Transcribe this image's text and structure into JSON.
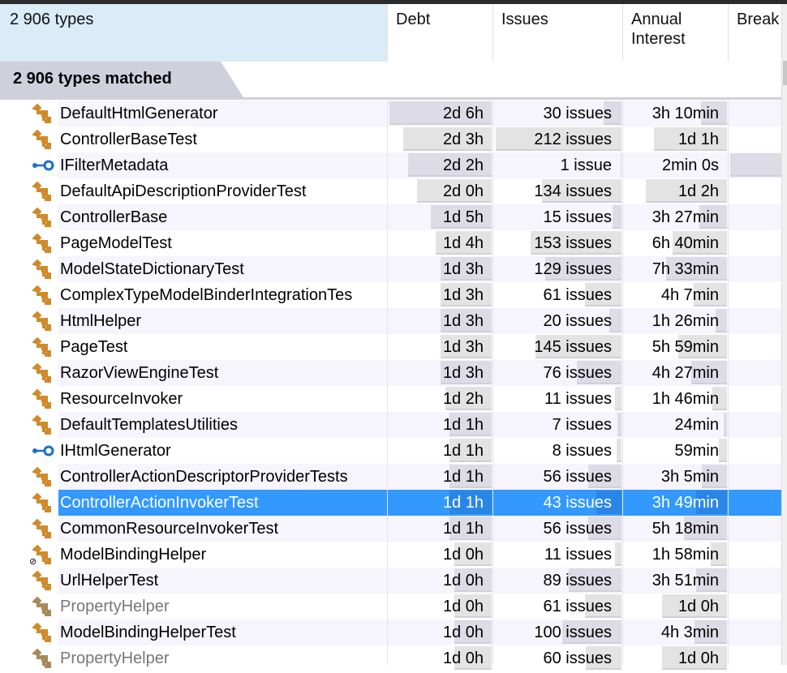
{
  "header": {
    "name": "2 906 types",
    "debt": "Debt",
    "issues": "Issues",
    "interest": "Annual Interest",
    "breaking": "Break"
  },
  "group": {
    "label": "2 906 types matched"
  },
  "colors": {
    "selection": "#3399ff",
    "class_icon": "#d08a2a",
    "interface_icon": "#1a6fc9",
    "group_header": "#cfd0dc",
    "header_first": "#d9ecf8"
  },
  "rows": [
    {
      "name": "DefaultHtmlGenerator",
      "icon": "class-icon",
      "debt": "2d  6h",
      "debt_h": 22,
      "issues": "30 issues",
      "issues_n": 30,
      "interest": "3h  10min",
      "interest_h": 3.17
    },
    {
      "name": "ControllerBaseTest",
      "icon": "class-icon",
      "debt": "2d  3h",
      "debt_h": 19,
      "issues": "212 issues",
      "issues_n": 212,
      "interest": "1d  1h",
      "interest_h": 9
    },
    {
      "name": "IFilterMetadata",
      "icon": "interface-icon",
      "debt": "2d  2h",
      "debt_h": 18,
      "issues": "1 issue",
      "issues_n": 1,
      "interest": "2min  0s",
      "interest_h": 0.03,
      "breaking": true
    },
    {
      "name": "DefaultApiDescriptionProviderTest",
      "icon": "class-icon",
      "debt": "2d  0h",
      "debt_h": 16,
      "issues": "134 issues",
      "issues_n": 134,
      "interest": "1d  2h",
      "interest_h": 10
    },
    {
      "name": "ControllerBase",
      "icon": "class-icon",
      "debt": "1d  5h",
      "debt_h": 13,
      "issues": "15 issues",
      "issues_n": 15,
      "interest": "3h  27min",
      "interest_h": 3.45
    },
    {
      "name": "PageModelTest",
      "icon": "class-icon",
      "debt": "1d  4h",
      "debt_h": 12,
      "issues": "153 issues",
      "issues_n": 153,
      "interest": "6h  40min",
      "interest_h": 6.67
    },
    {
      "name": "ModelStateDictionaryTest",
      "icon": "class-icon",
      "debt": "1d  3h",
      "debt_h": 11,
      "issues": "129 issues",
      "issues_n": 129,
      "interest": "7h  33min",
      "interest_h": 7.55
    },
    {
      "name": "ComplexTypeModelBinderIntegrationTes",
      "icon": "class-icon",
      "debt": "1d  3h",
      "debt_h": 11,
      "issues": "61 issues",
      "issues_n": 61,
      "interest": "4h  7min",
      "interest_h": 4.12
    },
    {
      "name": "HtmlHelper",
      "icon": "class-icon",
      "debt": "1d  3h",
      "debt_h": 11,
      "issues": "20 issues",
      "issues_n": 20,
      "interest": "1h  26min",
      "interest_h": 1.43
    },
    {
      "name": "PageTest",
      "icon": "class-icon",
      "debt": "1d  3h",
      "debt_h": 11,
      "issues": "145 issues",
      "issues_n": 145,
      "interest": "5h  59min",
      "interest_h": 5.98
    },
    {
      "name": "RazorViewEngineTest",
      "icon": "class-icon",
      "debt": "1d  3h",
      "debt_h": 11,
      "issues": "76 issues",
      "issues_n": 76,
      "interest": "4h  27min",
      "interest_h": 4.45
    },
    {
      "name": "ResourceInvoker",
      "icon": "class-icon",
      "debt": "1d  2h",
      "debt_h": 10,
      "issues": "11 issues",
      "issues_n": 11,
      "interest": "1h  46min",
      "interest_h": 1.77
    },
    {
      "name": "DefaultTemplatesUtilities",
      "icon": "class-icon",
      "debt": "1d  1h",
      "debt_h": 9,
      "issues": "7 issues",
      "issues_n": 7,
      "interest": "24min",
      "interest_h": 0.4
    },
    {
      "name": "IHtmlGenerator",
      "icon": "interface-icon",
      "debt": "1d  1h",
      "debt_h": 9,
      "issues": "8 issues",
      "issues_n": 8,
      "interest": "59min",
      "interest_h": 0.98
    },
    {
      "name": "ControllerActionDescriptorProviderTests",
      "icon": "class-icon",
      "debt": "1d  1h",
      "debt_h": 9,
      "issues": "56 issues",
      "issues_n": 56,
      "interest": "3h  5min",
      "interest_h": 3.08
    },
    {
      "name": "ControllerActionInvokerTest",
      "icon": "class-icon",
      "debt": "1d  1h",
      "debt_h": 9,
      "issues": "43 issues",
      "issues_n": 43,
      "interest": "3h  49min",
      "interest_h": 3.82,
      "selected": true
    },
    {
      "name": "CommonResourceInvokerTest",
      "icon": "class-icon",
      "debt": "1d  1h",
      "debt_h": 9,
      "issues": "56 issues",
      "issues_n": 56,
      "interest": "5h  18min",
      "interest_h": 5.3
    },
    {
      "name": "ModelBindingHelper",
      "icon": "class-icon",
      "debt": "1d  0h",
      "debt_h": 8,
      "issues": "11 issues",
      "issues_n": 11,
      "interest": "1h  58min",
      "interest_h": 1.97,
      "badge": "static"
    },
    {
      "name": "UrlHelperTest",
      "icon": "class-icon",
      "debt": "1d  0h",
      "debt_h": 8,
      "issues": "89 issues",
      "issues_n": 89,
      "interest": "3h  51min",
      "interest_h": 3.85
    },
    {
      "name": "PropertyHelper",
      "icon": "class-icon-gray",
      "debt": "1d  0h",
      "debt_h": 8,
      "issues": "61 issues",
      "issues_n": 61,
      "interest": "1d  0h",
      "interest_h": 8,
      "gray": true
    },
    {
      "name": "ModelBindingHelperTest",
      "icon": "class-icon",
      "debt": "1d  0h",
      "debt_h": 8,
      "issues": "100 issues",
      "issues_n": 100,
      "interest": "4h  3min",
      "interest_h": 4.05
    },
    {
      "name": "PropertyHelper",
      "icon": "class-icon-gray",
      "debt": "1d  0h",
      "debt_h": 8,
      "issues": "60 issues",
      "issues_n": 60,
      "interest": "1d  0h",
      "interest_h": 8,
      "gray": true
    }
  ]
}
